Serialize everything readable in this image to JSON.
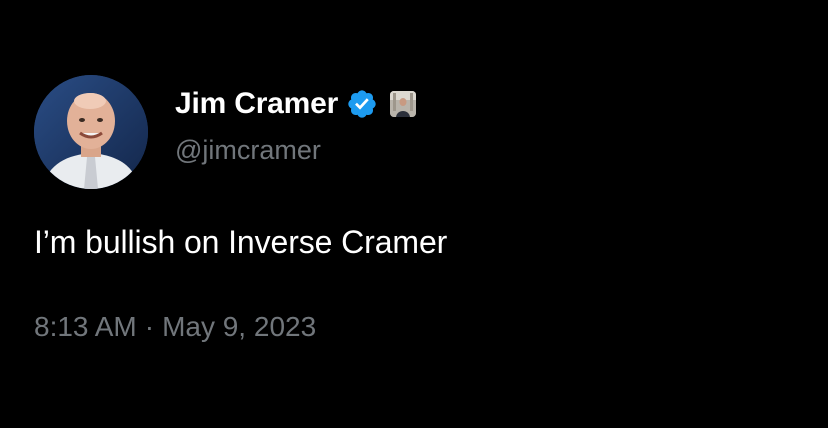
{
  "tweet": {
    "author": {
      "display_name": "Jim Cramer",
      "handle": "@jimcramer",
      "verified": true,
      "avatar_icon": "profile-photo",
      "affiliation_icon": "affiliate-badge-image"
    },
    "text": "I’m bullish on Inverse Cramer",
    "time": "8:13 AM",
    "separator": "·",
    "date": "May 9, 2023"
  },
  "colors": {
    "background": "#000000",
    "primary_text": "#ffffff",
    "secondary_text": "#71767b",
    "verified_blue": "#1d9bf0"
  }
}
